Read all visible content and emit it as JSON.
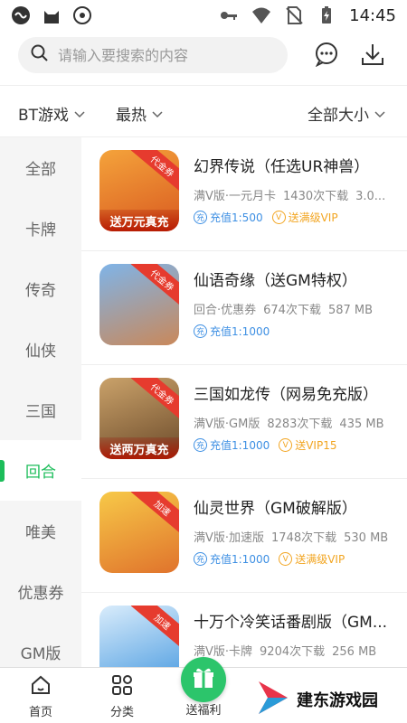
{
  "status_bar": {
    "time": "14:45"
  },
  "search": {
    "placeholder": "请输入要搜索的内容"
  },
  "filters": {
    "type": "BT游戏",
    "sort": "最热",
    "size": "全部大小"
  },
  "sidebar": {
    "items": [
      {
        "label": "全部"
      },
      {
        "label": "卡牌"
      },
      {
        "label": "传奇"
      },
      {
        "label": "仙侠"
      },
      {
        "label": "三国"
      },
      {
        "label": "回合",
        "active": true
      },
      {
        "label": "唯美"
      },
      {
        "label": "优惠券"
      },
      {
        "label": "GM版"
      }
    ]
  },
  "games": [
    {
      "title": "幻界传说（任选UR神兽）",
      "meta": [
        "满V版·一元月卡",
        "1430次下载",
        "3.0..."
      ],
      "tags": [
        {
          "kind": "blue",
          "icon": "充",
          "text": "充值1:500"
        },
        {
          "kind": "gold",
          "icon": "V",
          "text": "送满级VIP"
        }
      ],
      "thumb": {
        "banner": "送万元真充",
        "ribbon": "代金券",
        "colors": [
          "#f4a33b",
          "#d95a20"
        ]
      }
    },
    {
      "title": "仙语奇缘（送GM特权）",
      "meta": [
        "回合·优惠券",
        "674次下载",
        "587 MB"
      ],
      "tags": [
        {
          "kind": "blue",
          "icon": "充",
          "text": "充值1:1000"
        }
      ],
      "thumb": {
        "banner": "",
        "ribbon": "代金券",
        "colors": [
          "#7fb4e8",
          "#c9885a"
        ]
      }
    },
    {
      "title": "三国如龙传（网易免充版）",
      "meta": [
        "满V版·GM版",
        "8283次下载",
        "435 MB"
      ],
      "tags": [
        {
          "kind": "blue",
          "icon": "充",
          "text": "充值1:1000"
        },
        {
          "kind": "gold",
          "icon": "V",
          "text": "送VIP15"
        }
      ],
      "thumb": {
        "banner": "送两万真充",
        "ribbon": "代金券",
        "colors": [
          "#caa26a",
          "#6b4a2a"
        ]
      }
    },
    {
      "title": "仙灵世界（GM破解版）",
      "meta": [
        "满V版·加速版",
        "1748次下载",
        "530 MB"
      ],
      "tags": [
        {
          "kind": "blue",
          "icon": "充",
          "text": "充值1:1000"
        },
        {
          "kind": "gold",
          "icon": "V",
          "text": "送满级VIP"
        }
      ],
      "thumb": {
        "banner": "",
        "ribbon": "加速",
        "colors": [
          "#f7c948",
          "#e0732c"
        ]
      }
    },
    {
      "title": "十万个冷笑话番剧版（GM...",
      "meta": [
        "满V版·卡牌",
        "9204次下载",
        "256 MB"
      ],
      "tags": [],
      "thumb": {
        "banner": "",
        "ribbon": "加速",
        "colors": [
          "#d9ecfb",
          "#4a9be0"
        ]
      }
    }
  ],
  "bottom_nav": {
    "home": "首页",
    "category": "分类",
    "gift": "送福利"
  },
  "watermark": {
    "text": "建东游戏园"
  },
  "colors": {
    "accent": "#1cbd5a",
    "tag_blue": "#3d8fe3",
    "tag_gold": "#f2a521"
  }
}
